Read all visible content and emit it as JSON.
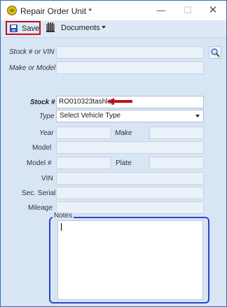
{
  "window": {
    "title": "Repair Order Unit *",
    "minimize_glyph": "—",
    "maximize_glyph": "☐",
    "close_glyph": "✕"
  },
  "toolbar": {
    "save_label": "Save",
    "documents_label": "Documents"
  },
  "search": {
    "stock_or_vin_label": "Stock # or VIN",
    "stock_or_vin_value": "",
    "make_or_model_label": "Make or Model",
    "make_or_model_value": ""
  },
  "unit": {
    "stock_label": "Stock #",
    "stock_value": "RO010323tashley",
    "type_label": "Type",
    "type_selected": "Select Vehicle Type",
    "year_label": "Year",
    "year_value": "",
    "make_label": "Make",
    "make_value": "",
    "model_label": "Model",
    "model_value": "",
    "model_number_label": "Model #",
    "model_number_value": "",
    "plate_label": "Plate",
    "plate_value": "",
    "vin_label": "VIN",
    "vin_value": "",
    "sec_serial_label": "Sec. Serial",
    "sec_serial_value": "",
    "mileage_label": "Mileage",
    "mileage_value": ""
  },
  "notes": {
    "legend": "Notes",
    "value": ""
  },
  "colors": {
    "highlight_red": "#c1121f",
    "notes_border": "#2b45c9",
    "form_background": "#d8e5f4"
  },
  "icons": {
    "app": "app-logo-icon",
    "save": "floppy-disk-icon",
    "documents": "documents-icon",
    "search": "magnifier-icon",
    "arrow": "red-arrow-icon"
  }
}
